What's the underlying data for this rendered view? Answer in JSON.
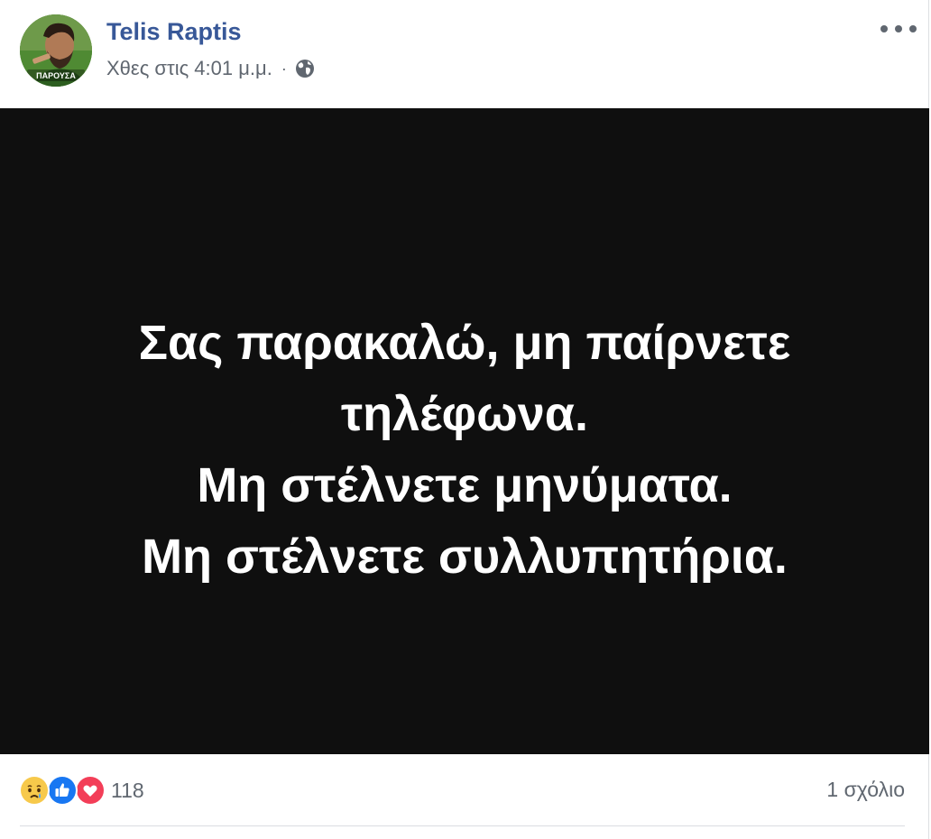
{
  "post": {
    "author": "Telis Raptis",
    "timestamp": "Χθες στις 4:01 μ.μ.",
    "separator": "·",
    "privacy_icon": "globe-icon",
    "avatar_caption": "ΠΑΡΟΥΣΑ",
    "image_text": [
      "Σας παρακαλώ, μη παίρνετε",
      "τηλέφωνα.",
      "Μη στέλνετε μηνύματα.",
      "Μη στέλνετε συλλυπητήρια."
    ]
  },
  "footer": {
    "reaction_icons": [
      "sad-reaction-icon",
      "like-reaction-icon",
      "love-reaction-icon"
    ],
    "reaction_count": "118",
    "comments_label": "1 σχόλιο"
  },
  "colors": {
    "author_link": "#385898",
    "meta_text": "#606770",
    "image_background": "#0f0f0f",
    "like_blue": "#1877f2",
    "love_red": "#f33e58",
    "sad_yellow": "#f7c94b"
  }
}
